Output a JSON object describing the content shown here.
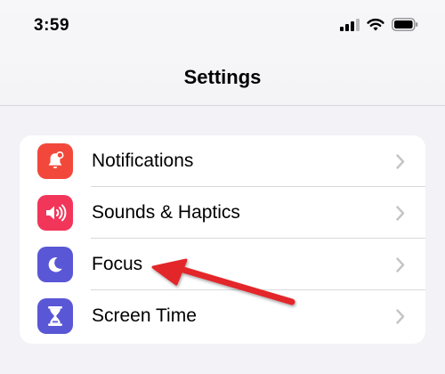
{
  "status_bar": {
    "time": "3:59",
    "icons": [
      "cellular-signal-icon",
      "wifi-icon",
      "battery-icon"
    ]
  },
  "header": {
    "title": "Settings"
  },
  "settings_group": {
    "items": [
      {
        "label": "Notifications",
        "icon": "bell-icon",
        "color": "#f2483b"
      },
      {
        "label": "Sounds & Haptics",
        "icon": "speaker-icon",
        "color": "#f1365a"
      },
      {
        "label": "Focus",
        "icon": "moon-icon",
        "color": "#5a57d6"
      },
      {
        "label": "Screen Time",
        "icon": "hourglass-icon",
        "color": "#5a57d6"
      }
    ]
  },
  "annotation": {
    "type": "arrow",
    "color": "#e3262b",
    "points_to": "Focus"
  }
}
